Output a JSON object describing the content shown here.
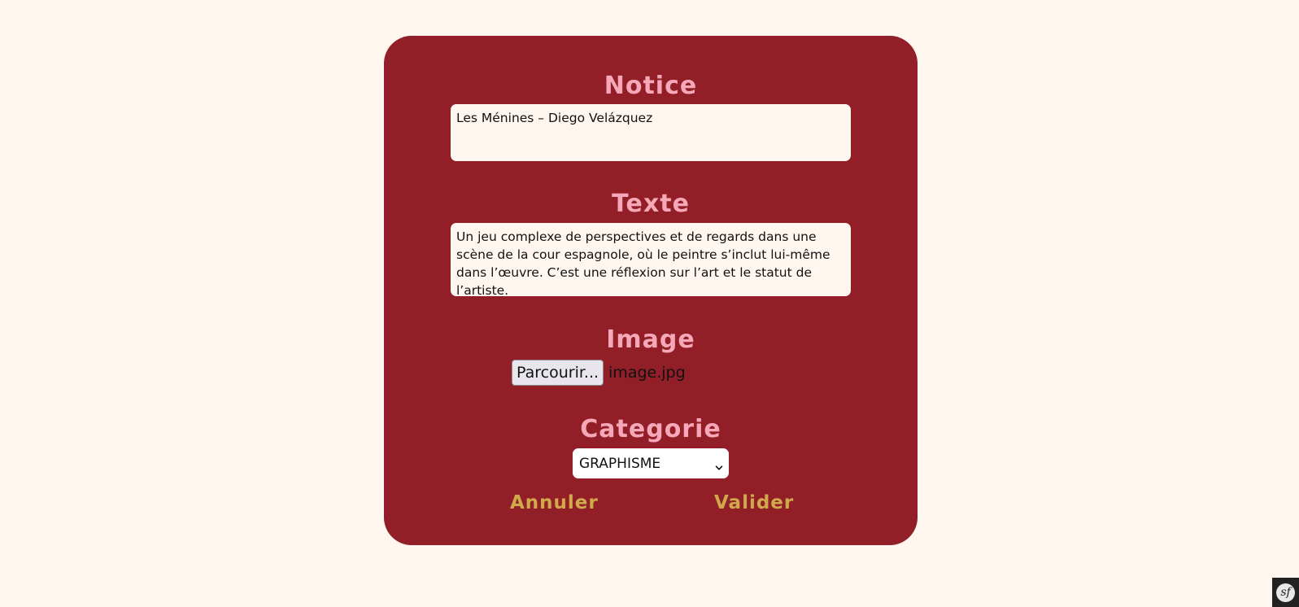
{
  "form": {
    "notice": {
      "title": "Notice",
      "value": "Les Ménines – Diego Velázquez"
    },
    "texte": {
      "title": "Texte",
      "value": "Un jeu complexe de perspectives et de regards dans une scène de la cour espagnole, où le peintre s’inclut lui-même dans l’œuvre. C’est une réflexion sur l’art et le statut de l’artiste."
    },
    "image": {
      "title": "Image",
      "button_label": "Parcourir...",
      "file_name": "image.jpg"
    },
    "categorie": {
      "title": "Categorie",
      "selected": "GRAPHISME"
    },
    "actions": {
      "cancel_label": "Annuler",
      "submit_label": "Valider"
    }
  },
  "toolbar": {
    "icon": "symfony-icon",
    "glyph": "sf"
  },
  "colors": {
    "page_background": "#fff6f0",
    "card_background": "#921f27",
    "title_pink": "#f6a8b8",
    "action_gold": "#d0a94a"
  },
  "icons": {
    "select_arrow": "chevron-down-icon"
  }
}
